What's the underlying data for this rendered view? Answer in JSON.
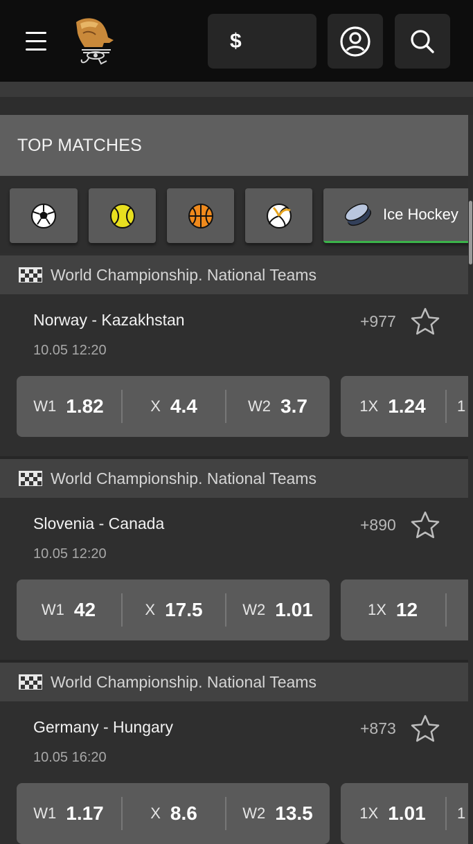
{
  "header": {
    "currency": "$",
    "icons": [
      "menu-icon",
      "logo",
      "account-icon",
      "search-icon"
    ]
  },
  "top_matches": {
    "title": "TOP MATCHES"
  },
  "sports": [
    {
      "icon": "football-icon",
      "label": ""
    },
    {
      "icon": "tennis-icon",
      "label": ""
    },
    {
      "icon": "basketball-icon",
      "label": ""
    },
    {
      "icon": "volleyball-icon",
      "label": ""
    },
    {
      "icon": "ice-hockey-icon",
      "label": "Ice Hockey",
      "active": true
    }
  ],
  "matches": [
    {
      "league": "World Championship. National Teams",
      "teams": "Norway - Kazakhstan",
      "time": "10.05 12:20",
      "more": "+977",
      "odds": [
        {
          "k": "W1",
          "v": "1.82"
        },
        {
          "k": "X",
          "v": "4.4"
        },
        {
          "k": "W2",
          "v": "3.7"
        }
      ],
      "odds2": [
        {
          "k": "1X",
          "v": "1.24"
        },
        {
          "k": "1",
          "v": ""
        }
      ]
    },
    {
      "league": "World Championship. National Teams",
      "teams": "Slovenia - Canada",
      "time": "10.05 12:20",
      "more": "+890",
      "odds": [
        {
          "k": "W1",
          "v": "42"
        },
        {
          "k": "X",
          "v": "17.5"
        },
        {
          "k": "W2",
          "v": "1.01"
        }
      ],
      "odds2": [
        {
          "k": "1X",
          "v": "12"
        }
      ]
    },
    {
      "league": "World Championship. National Teams",
      "teams": "Germany - Hungary",
      "time": "10.05 16:20",
      "more": "+873",
      "odds": [
        {
          "k": "W1",
          "v": "1.17"
        },
        {
          "k": "X",
          "v": "8.6"
        },
        {
          "k": "W2",
          "v": "13.5"
        }
      ],
      "odds2": [
        {
          "k": "1X",
          "v": "1.01"
        },
        {
          "k": "1",
          "v": ""
        }
      ]
    }
  ],
  "colors": {
    "accent": "#3bb34a",
    "panel": "#5a5a5a",
    "background": "#2f2f2f"
  }
}
